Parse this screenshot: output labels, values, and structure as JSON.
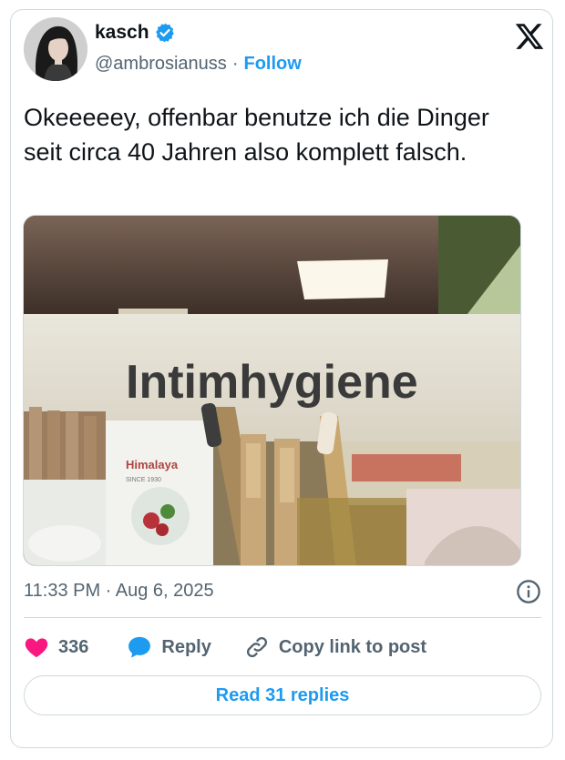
{
  "author": {
    "display_name": "kasch",
    "handle": "@ambrosianuss",
    "separator": "·",
    "follow_label": "Follow",
    "verified_icon": "verified-badge-icon"
  },
  "tweet": {
    "text": "Okeeeeey, offenbar benutze ich die Dinger seit circa 40 Jahren also komplett falsch.",
    "timestamp": "11:33 PM · Aug 6, 2025"
  },
  "media": {
    "sign_text": "Intimhygiene",
    "brand_text": "Himalaya",
    "brand_sub": "SINCE 1930"
  },
  "actions": {
    "like_count": "336",
    "reply_label": "Reply",
    "copy_link_label": "Copy link to post",
    "read_replies_label": "Read 31 replies"
  },
  "colors": {
    "accent": "#1d9bf0",
    "like": "#f91880",
    "muted": "#536471"
  }
}
